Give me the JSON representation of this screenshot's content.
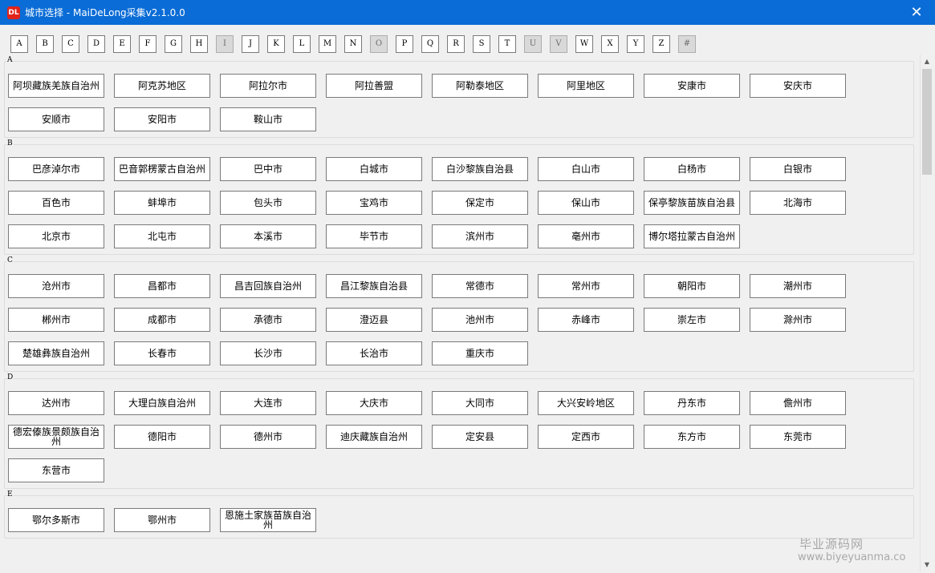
{
  "window": {
    "title": "城市选择 - MaiDeLong采集v2.1.0.0",
    "app_icon": "DL",
    "close_glyph": "✕"
  },
  "letters": [
    {
      "label": "A",
      "enabled": true
    },
    {
      "label": "B",
      "enabled": true
    },
    {
      "label": "C",
      "enabled": true
    },
    {
      "label": "D",
      "enabled": true
    },
    {
      "label": "E",
      "enabled": true
    },
    {
      "label": "F",
      "enabled": true
    },
    {
      "label": "G",
      "enabled": true
    },
    {
      "label": "H",
      "enabled": true
    },
    {
      "label": "I",
      "enabled": false
    },
    {
      "label": "J",
      "enabled": true
    },
    {
      "label": "K",
      "enabled": true
    },
    {
      "label": "L",
      "enabled": true
    },
    {
      "label": "M",
      "enabled": true
    },
    {
      "label": "N",
      "enabled": true
    },
    {
      "label": "O",
      "enabled": false
    },
    {
      "label": "P",
      "enabled": true
    },
    {
      "label": "Q",
      "enabled": true
    },
    {
      "label": "R",
      "enabled": true
    },
    {
      "label": "S",
      "enabled": true
    },
    {
      "label": "T",
      "enabled": true
    },
    {
      "label": "U",
      "enabled": false
    },
    {
      "label": "V",
      "enabled": false
    },
    {
      "label": "W",
      "enabled": true
    },
    {
      "label": "X",
      "enabled": true
    },
    {
      "label": "Y",
      "enabled": true
    },
    {
      "label": "Z",
      "enabled": true
    },
    {
      "label": "#",
      "enabled": false
    }
  ],
  "sections": [
    {
      "letter": "A",
      "cities": [
        "阿坝藏族羌族自治州",
        "阿克苏地区",
        "阿拉尔市",
        "阿拉善盟",
        "阿勒泰地区",
        "阿里地区",
        "安康市",
        "安庆市",
        "安顺市",
        "安阳市",
        "鞍山市"
      ]
    },
    {
      "letter": "B",
      "cities": [
        "巴彦淖尔市",
        "巴音郭楞蒙古自治州",
        "巴中市",
        "白城市",
        "白沙黎族自治县",
        "白山市",
        "白杨市",
        "白银市",
        "百色市",
        "蚌埠市",
        "包头市",
        "宝鸡市",
        "保定市",
        "保山市",
        "保亭黎族苗族自治县",
        "北海市",
        "北京市",
        "北屯市",
        "本溪市",
        "毕节市",
        "滨州市",
        "亳州市",
        "博尔塔拉蒙古自治州"
      ]
    },
    {
      "letter": "C",
      "cities": [
        "沧州市",
        "昌都市",
        "昌吉回族自治州",
        "昌江黎族自治县",
        "常德市",
        "常州市",
        "朝阳市",
        "潮州市",
        "郴州市",
        "成都市",
        "承德市",
        "澄迈县",
        "池州市",
        "赤峰市",
        "崇左市",
        "滁州市",
        "楚雄彝族自治州",
        "长春市",
        "长沙市",
        "长治市",
        "重庆市"
      ]
    },
    {
      "letter": "D",
      "cities": [
        "达州市",
        "大理白族自治州",
        "大连市",
        "大庆市",
        "大同市",
        "大兴安岭地区",
        "丹东市",
        "儋州市",
        "德宏傣族景颇族自治州",
        "德阳市",
        "德州市",
        "迪庆藏族自治州",
        "定安县",
        "定西市",
        "东方市",
        "东莞市",
        "东营市"
      ]
    },
    {
      "letter": "E",
      "cities": [
        "鄂尔多斯市",
        "鄂州市",
        "恩施土家族苗族自治州"
      ]
    }
  ],
  "watermark": {
    "line1": "毕业源码网",
    "line2": "www.biyeyuanma.co"
  },
  "scrollbar": {
    "up_glyph": "▲",
    "down_glyph": "▼"
  }
}
